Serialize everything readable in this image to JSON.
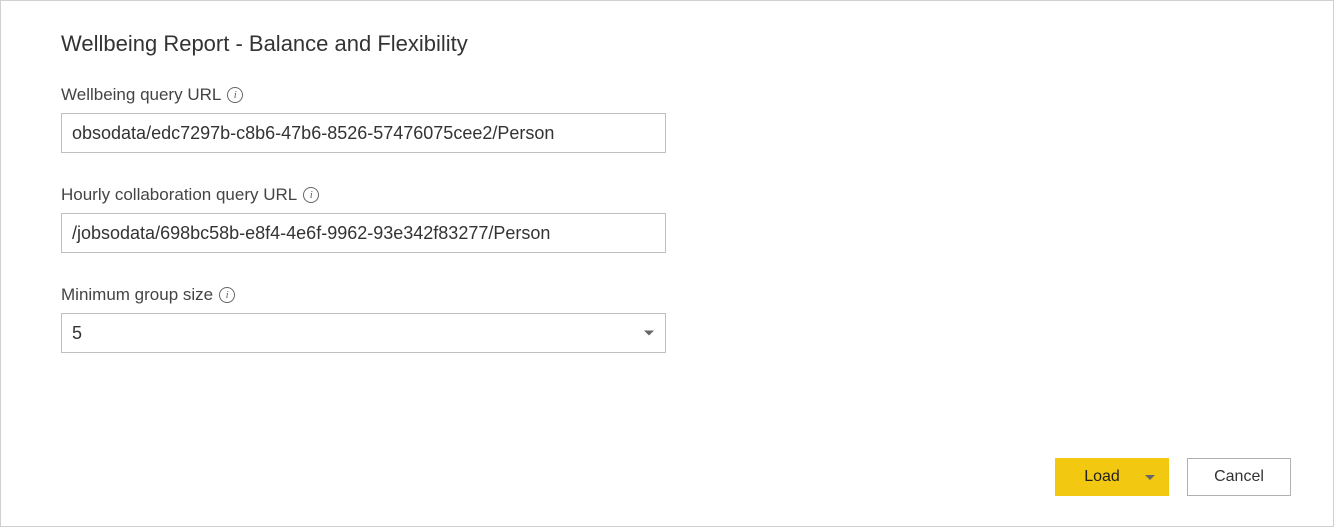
{
  "dialog": {
    "title": "Wellbeing Report - Balance and Flexibility"
  },
  "fields": {
    "wellbeing_url": {
      "label": "Wellbeing query URL",
      "value": "obsodata/edc7297b-c8b6-47b6-8526-57476075cee2/Person"
    },
    "hourly_url": {
      "label": "Hourly collaboration query URL",
      "value": "/jobsodata/698bc58b-e8f4-4e6f-9962-93e342f83277/Person"
    },
    "min_group": {
      "label": "Minimum group size",
      "value": "5"
    }
  },
  "footer": {
    "load_label": "Load",
    "cancel_label": "Cancel"
  },
  "icons": {
    "info_glyph": "i"
  }
}
